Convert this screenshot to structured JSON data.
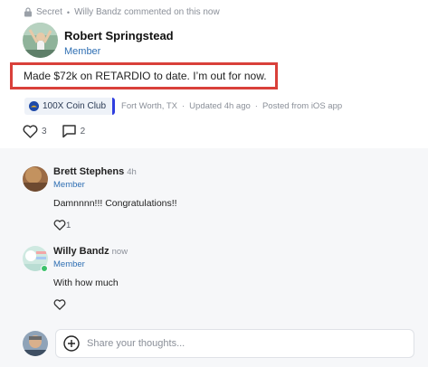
{
  "post": {
    "visibility": "Secret",
    "activity_user": "Willy Bandz",
    "activity_text": "commented on this",
    "activity_time": "now",
    "author_name": "Robert Springstead",
    "author_role": "Member",
    "body": "Made $72k on RETARDIO to date. I’m out for now.",
    "club": "100X Coin Club",
    "location": "Fort Worth, TX",
    "updated": "Updated 4h ago",
    "source": "Posted from iOS app",
    "likes": "3",
    "comments": "2"
  },
  "comments": [
    {
      "name": "Brett Stephens",
      "time": "4h",
      "role": "Member",
      "text": "Damnnnn!!! Congratulations!!",
      "likes": "1"
    },
    {
      "name": "Willy Bandz",
      "time": "now",
      "role": "Member",
      "text": "With how much",
      "likes": ""
    }
  ],
  "composer": {
    "placeholder": "Share your thoughts..."
  },
  "colors": {
    "highlight_border": "#d9403a",
    "role_text": "#2f6fb3",
    "club_accent": "#2f3ee0",
    "online_dot": "#3cc16b"
  },
  "icons": [
    "lock-icon",
    "club-badge-icon",
    "heart-icon",
    "comment-icon",
    "plus-circle-icon"
  ]
}
